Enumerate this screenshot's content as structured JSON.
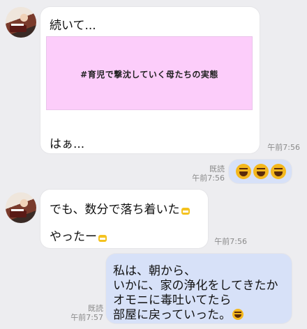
{
  "messages": [
    {
      "line1": "続いて...",
      "image_caption": "#育児で撃沈していく母たちの実態",
      "line2": "はぁ...",
      "time": "午前7:56"
    },
    {
      "read": "既読",
      "time": "午前7:56"
    },
    {
      "line1": "でも、数分で落ち着いた",
      "line2": "やったー",
      "time": "午前7:56"
    },
    {
      "lines": [
        "私は、朝から、",
        "いかに、家の浄化をしてきたか",
        "オモニに毒吐いてたら",
        "部屋に戻っていった。"
      ],
      "read": "既読",
      "time": "午前7:57"
    }
  ]
}
